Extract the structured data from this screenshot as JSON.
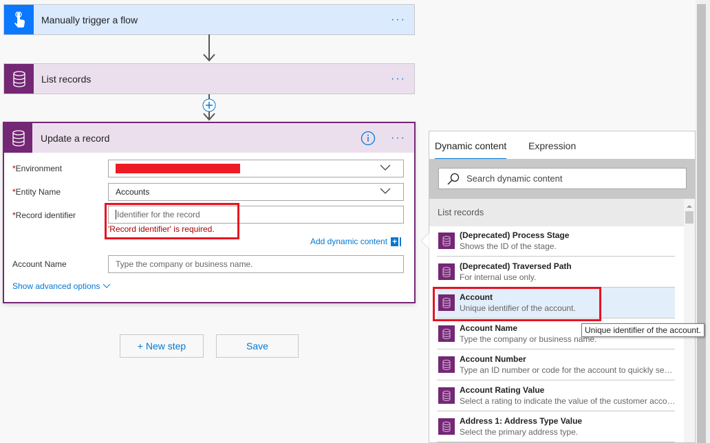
{
  "flow": {
    "trigger": {
      "title": "Manually trigger a flow",
      "icon": "hand-pointer-icon",
      "color": "#0078ff"
    },
    "list_records": {
      "title": "List records",
      "icon": "database-icon",
      "color": "#742774"
    },
    "update": {
      "title": "Update a record",
      "fields": [
        {
          "label": "Environment",
          "required": true,
          "value": "",
          "redacted": true
        },
        {
          "label": "Entity Name",
          "required": true,
          "value": "Accounts"
        },
        {
          "label": "Record identifier",
          "required": true,
          "placeholder": "Identifier for the record",
          "error": "'Record identifier' is required."
        },
        {
          "label": "Account Name",
          "required": false,
          "placeholder": "Type the company or business name."
        }
      ],
      "add_dynamic": "Add dynamic content",
      "advanced": "Show advanced options"
    },
    "new_step": "+ New step",
    "save": "Save"
  },
  "panel": {
    "tabs": [
      "Dynamic content",
      "Expression"
    ],
    "active_tab": 0,
    "search_placeholder": "Search dynamic content",
    "section": "List records",
    "items": [
      {
        "title": "(Deprecated) Process Stage",
        "desc": "Shows the ID of the stage."
      },
      {
        "title": "(Deprecated) Traversed Path",
        "desc": "For internal use only."
      },
      {
        "title": "Account",
        "desc": "Unique identifier of the account.",
        "highlighted": true
      },
      {
        "title": "Account Name",
        "desc": "Type the company or business name."
      },
      {
        "title": "Account Number",
        "desc": "Type an ID number or code for the account to quickly search and identify the account"
      },
      {
        "title": "Account Rating Value",
        "desc": "Select a rating to indicate the value of the customer account"
      },
      {
        "title": "Address 1: Address Type Value",
        "desc": "Select the primary address type."
      }
    ],
    "tooltip": "Unique identifier of the account."
  },
  "colors": {
    "accent": "#0078d4",
    "error": "#a80000",
    "highlight": "#e8f2fc",
    "annotation": "#e81123"
  }
}
